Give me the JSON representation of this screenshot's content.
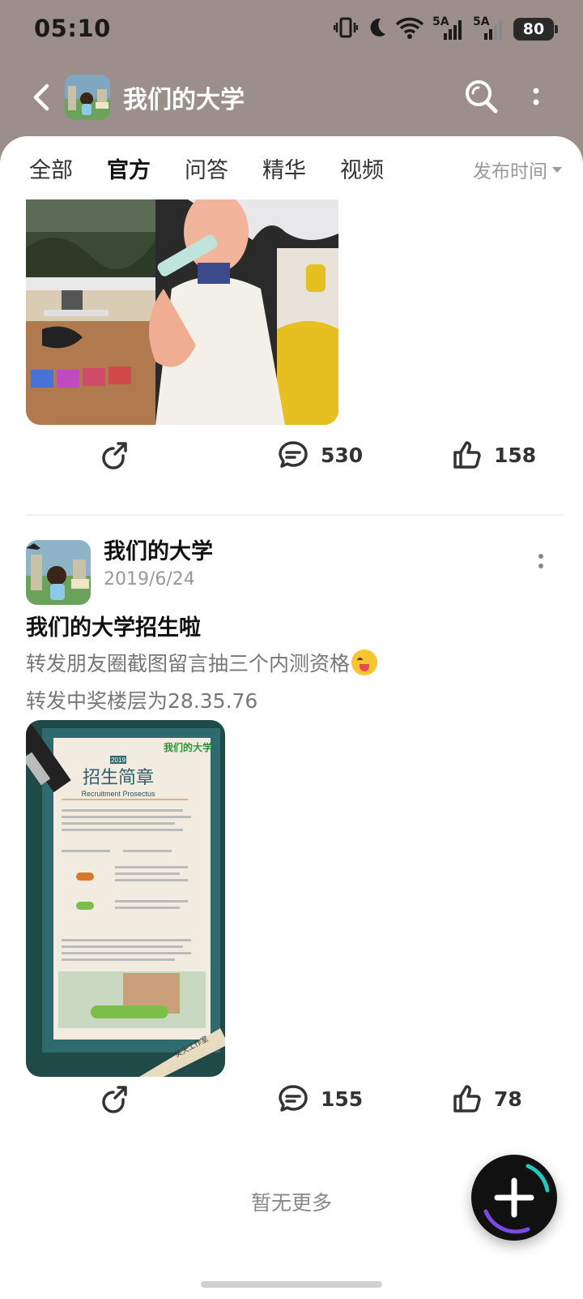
{
  "status_bar": {
    "time": "05:10",
    "network_1": "5A",
    "network_2": "5A",
    "battery": "80"
  },
  "header": {
    "title": "我们的大学",
    "back_icon": "back-arrow-icon",
    "search_icon": "search-icon",
    "more_icon": "more-vertical-icon"
  },
  "tabs": [
    {
      "label": "全部",
      "active": false
    },
    {
      "label": "官方",
      "active": true
    },
    {
      "label": "问答",
      "active": false
    },
    {
      "label": "精华",
      "active": false
    },
    {
      "label": "视频",
      "active": false
    }
  ],
  "sort": {
    "label": "发布时间"
  },
  "post1": {
    "actions": {
      "comments": "530",
      "likes": "158"
    }
  },
  "post2": {
    "author": "我们的大学",
    "date": "2019/6/24",
    "title": "我们的大学招生啦",
    "body_line1": "转发朋友圈截图留言抽三个内测资格",
    "body_line2": "转发中奖楼层为28.35.76",
    "poster": {
      "year": "2019",
      "brand": "我们的大学",
      "heading": "招生简章",
      "subheading": "Recruitment Prosectus",
      "footer": "笑天工作室"
    },
    "actions": {
      "comments": "155",
      "likes": "78"
    }
  },
  "footer": {
    "no_more": "暂无更多"
  },
  "colors": {
    "accent": "#23c9c0",
    "header_bg": "#9c8f8b"
  }
}
